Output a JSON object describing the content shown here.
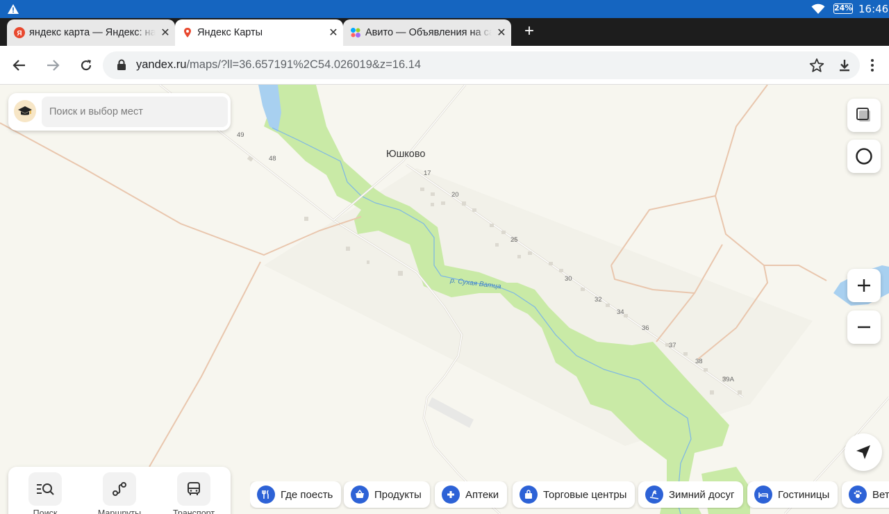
{
  "status_bar": {
    "time": "16:46",
    "battery": "24%"
  },
  "tabs": [
    {
      "title": "яндекс карта — Яндекс: нашлось",
      "favicon": "yandex-icon",
      "active": false
    },
    {
      "title": "Яндекс Карты",
      "favicon": "map-pin-icon",
      "active": true
    },
    {
      "title": "Авито — Объявления на сайте",
      "favicon": "avito-icon",
      "active": false
    }
  ],
  "toolbar": {
    "url_host": "yandex.ru",
    "url_path": "/maps/?ll=36.657191%2C54.026019&z=16.14"
  },
  "map": {
    "village_name": "Юшково",
    "river_name": "р. Сухая Ватца",
    "house_numbers": [
      "49",
      "48",
      "17",
      "20",
      "25",
      "30",
      "32",
      "34",
      "36",
      "37",
      "38",
      "39А"
    ]
  },
  "search": {
    "placeholder": "Поиск и выбор мест"
  },
  "bottom_nav": [
    {
      "label": "Поиск",
      "icon": "search-list-icon"
    },
    {
      "label": "Маршруты",
      "icon": "route-icon"
    },
    {
      "label": "Транспорт",
      "icon": "bus-icon"
    }
  ],
  "categories": [
    {
      "label": "Где поесть",
      "icon": "fork-knife-icon"
    },
    {
      "label": "Продукты",
      "icon": "basket-icon"
    },
    {
      "label": "Аптеки",
      "icon": "pharmacy-cross-icon"
    },
    {
      "label": "Торговые центры",
      "icon": "shopping-bag-icon"
    },
    {
      "label": "Зимний досуг",
      "icon": "ski-icon"
    },
    {
      "label": "Гостиницы",
      "icon": "bed-icon"
    },
    {
      "label": "Ветеринарные клиники",
      "icon": "vet-icon"
    }
  ],
  "colors": {
    "status_bar": "#1565c0",
    "tab_strip": "#1d1d1d",
    "map_background": "#f7f6ef",
    "forest": "#c9eaa6",
    "water": "#a8d0f0",
    "road_orange": "#e9c6ad",
    "accent_blue": "#2d62d6"
  }
}
